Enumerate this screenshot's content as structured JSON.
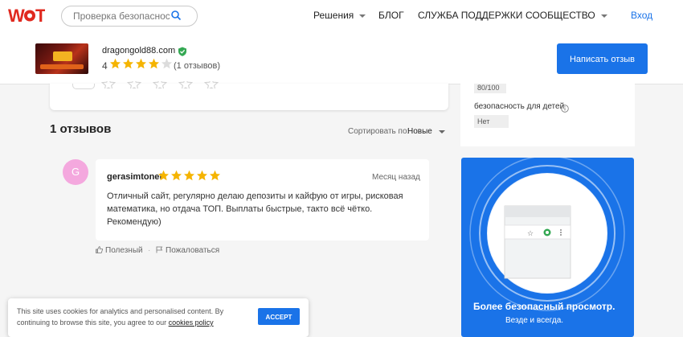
{
  "header": {
    "search_placeholder": "Проверка безопасности",
    "nav": [
      {
        "label": "Решения",
        "has_dropdown": true
      },
      {
        "label": "БЛОГ",
        "has_dropdown": false
      },
      {
        "label": "СЛУЖБА ПОДДЕРЖКИ",
        "has_dropdown": false
      },
      {
        "label": "СООБЩЕСТВО",
        "has_dropdown": true
      }
    ],
    "login": "Вход"
  },
  "site": {
    "domain": "dragongold88.com",
    "rating": "4",
    "stars_filled": 4,
    "stars_total": 5,
    "reviews_count": "(1 отзывов)",
    "write_review": "Написать отзыв"
  },
  "reviews": {
    "heading": "1 отзывов",
    "sort_label": "Сортировать по:",
    "sort_value": "Новые",
    "items": [
      {
        "avatar_letter": "G",
        "author": "gerasimtonet",
        "stars": 5,
        "date": "Месяц назад",
        "text": "Отличный сайт, регулярно делаю депозиты и кайфую от игры, рисковая математика, но отдача ТОП. Выплаты быстрые, тактo всё чётко. Рекомендую)",
        "helpful": "Полезный",
        "report": "Пожаловаться"
      }
    ]
  },
  "sidebar": {
    "score": "80/100",
    "kids_label": "безопасность для детей",
    "kids_value": "Нет",
    "promo_title": "Более безопасный просмотр.",
    "promo_sub": "Везде и всегда."
  },
  "cookie": {
    "text": "This site uses cookies for analytics and personalised content. By continuing to browse this site, you agree to our",
    "link": "cookies policy",
    "accept": "ACCEPT"
  },
  "colors": {
    "brand_blue": "#1a73e8",
    "logo_red": "#e0291f",
    "star": "#f5b400",
    "verified": "#34a853",
    "avatar": "#f4a8de"
  }
}
